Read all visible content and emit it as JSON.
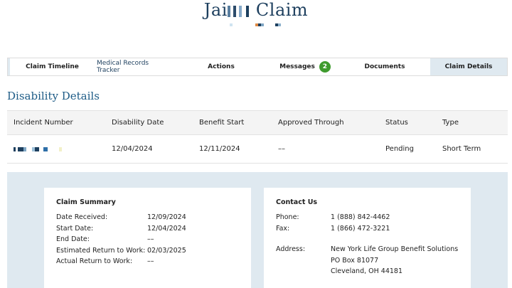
{
  "header": {
    "title_prefix": "Jai",
    "title_suffix": "Claim"
  },
  "tabs": [
    {
      "label": "Claim Timeline"
    },
    {
      "label": "Medical Records Tracker"
    },
    {
      "label": "Actions"
    },
    {
      "label": "Messages",
      "badge": "2"
    },
    {
      "label": "Documents"
    },
    {
      "label": "Claim Details"
    }
  ],
  "section_title": "Disability Details",
  "table": {
    "columns": [
      "Incident Number",
      "Disability Date",
      "Benefit Start",
      "Approved Through",
      "Status",
      "Type"
    ],
    "row": {
      "disability_date": "12/04/2024",
      "benefit_start": "12/11/2024",
      "approved_through": "––",
      "status": "Pending",
      "type": "Short Term"
    }
  },
  "claim_summary": {
    "title": "Claim Summary",
    "items": [
      {
        "label": "Date Received:",
        "value": "12/09/2024"
      },
      {
        "label": "Start Date:",
        "value": "12/04/2024"
      },
      {
        "label": "End Date:",
        "value": "––"
      },
      {
        "label": "Estimated Return to Work:",
        "value": "02/03/2025"
      },
      {
        "label": "Actual Return to Work:",
        "value": "––"
      }
    ]
  },
  "contact": {
    "title": "Contact Us",
    "phone_label": "Phone:",
    "phone": "1 (888) 842-4462",
    "fax_label": "Fax:",
    "fax": "1 (866) 472-3221",
    "address_label": "Address:",
    "address_lines": [
      "New York Life Group Benefit Solutions",
      "PO Box 81077",
      "Cleveland, OH 44181"
    ]
  }
}
